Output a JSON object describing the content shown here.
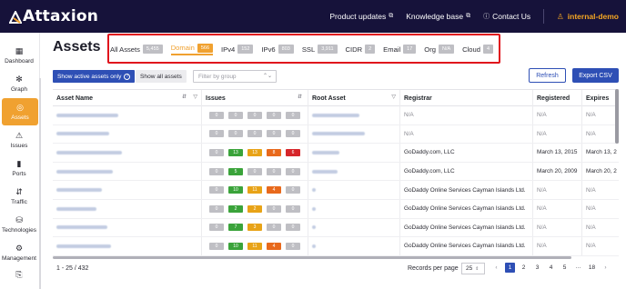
{
  "app": {
    "logo_text": "Attaxion",
    "top_links": [
      {
        "label": "Product updates"
      },
      {
        "label": "Knowledge base"
      },
      {
        "label": "Contact Us"
      }
    ],
    "user": "internal-demo"
  },
  "sidebar": {
    "items": [
      {
        "label": "Dashboard",
        "icon": "dashboard-icon"
      },
      {
        "label": "Graph",
        "icon": "graph-icon"
      },
      {
        "label": "Assets",
        "icon": "assets-icon",
        "active": true
      },
      {
        "label": "Issues",
        "icon": "issues-icon"
      },
      {
        "label": "Ports",
        "icon": "ports-icon"
      },
      {
        "label": "Traffic",
        "icon": "traffic-icon"
      },
      {
        "label": "Technologies",
        "icon": "technologies-icon"
      },
      {
        "label": "Management",
        "icon": "management-icon"
      }
    ]
  },
  "page": {
    "title": "Assets",
    "tabs": [
      {
        "label": "All Assets",
        "count": "5,455"
      },
      {
        "label": "Domain",
        "count": "566",
        "active": true
      },
      {
        "label": "IPv4",
        "count": "152"
      },
      {
        "label": "IPv6",
        "count": "803"
      },
      {
        "label": "SSL",
        "count": "3,911"
      },
      {
        "label": "CIDR",
        "count": "2"
      },
      {
        "label": "Email",
        "count": "17"
      },
      {
        "label": "Org",
        "count": "N/A"
      },
      {
        "label": "Cloud",
        "count": "4"
      }
    ],
    "filters": {
      "show_active": "Show active assets only",
      "show_all": "Show all assets",
      "group_placeholder": "Filter by group"
    },
    "actions": {
      "refresh": "Refresh",
      "export": "Export CSV"
    }
  },
  "table": {
    "columns": [
      "Asset Name",
      "Issues",
      "Root Asset",
      "Registrar",
      "Registered",
      "Expires"
    ],
    "rows": [
      {
        "issues": [
          "0",
          "0",
          "0",
          "0",
          "0"
        ],
        "registrar": "N/A",
        "registered": "N/A",
        "expires": "N/A"
      },
      {
        "issues": [
          "0",
          "0",
          "0",
          "0",
          "0"
        ],
        "registrar": "N/A",
        "registered": "N/A",
        "expires": "N/A"
      },
      {
        "issues": [
          "0",
          "13",
          "13",
          "8",
          "6"
        ],
        "registrar": "GoDaddy.com, LLC",
        "registered": "March 13, 2015",
        "expires": "March 13, 2"
      },
      {
        "issues": [
          "0",
          "5",
          "0",
          "0",
          "0"
        ],
        "registrar": "GoDaddy.com, LLC",
        "registered": "March 20, 2009",
        "expires": "March 20, 2"
      },
      {
        "issues": [
          "0",
          "10",
          "11",
          "4",
          "0"
        ],
        "registrar": "GoDaddy Online Services Cayman Islands Ltd.",
        "registered": "N/A",
        "expires": "N/A"
      },
      {
        "issues": [
          "0",
          "2",
          "2",
          "0",
          "0"
        ],
        "registrar": "GoDaddy Online Services Cayman Islands Ltd.",
        "registered": "N/A",
        "expires": "N/A"
      },
      {
        "issues": [
          "0",
          "7",
          "3",
          "0",
          "0"
        ],
        "registrar": "GoDaddy Online Services Cayman Islands Ltd.",
        "registered": "N/A",
        "expires": "N/A"
      },
      {
        "issues": [
          "0",
          "10",
          "11",
          "4",
          "0"
        ],
        "registrar": "GoDaddy Online Services Cayman Islands Ltd.",
        "registered": "N/A",
        "expires": "N/A"
      }
    ],
    "severity_colors": [
      "#bfbfc4",
      "#3aa33a",
      "#e8a317",
      "#e8691c",
      "#d6262b"
    ]
  },
  "footer": {
    "range": "1 - 25 / 432",
    "rpp_label": "Records per page",
    "rpp_value": "25",
    "pages": [
      "1",
      "2",
      "3",
      "4",
      "5",
      "···",
      "18"
    ],
    "current_page": "1"
  }
}
